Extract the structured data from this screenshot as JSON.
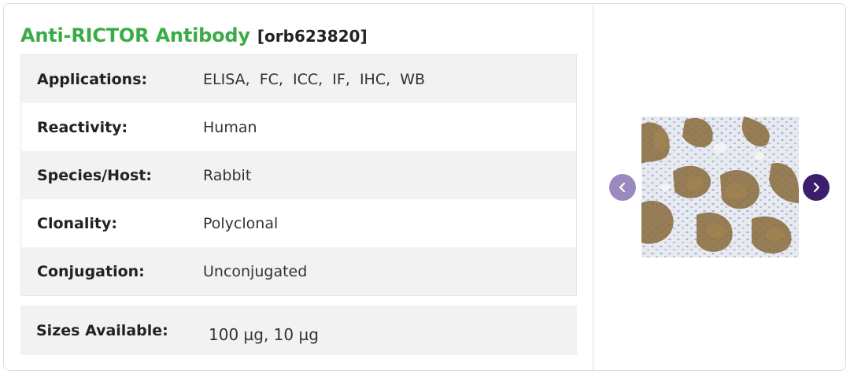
{
  "product": {
    "title": "Anti-RICTOR Antibody",
    "catalog_number": "[orb623820]"
  },
  "specs": [
    {
      "label": "Applications:",
      "value": "ELISA,  FC,  ICC,  IF,  IHC,  WB"
    },
    {
      "label": "Reactivity:",
      "value": "Human"
    },
    {
      "label": "Species/Host:",
      "value": "Rabbit"
    },
    {
      "label": "Clonality:",
      "value": "Polyclonal"
    },
    {
      "label": "Conjugation:",
      "value": "Unconjugated"
    }
  ],
  "sizes": {
    "label": "Sizes Available:",
    "value": "100 µg, 10 µg"
  },
  "gallery": {
    "prev_icon": "chevron-left-icon",
    "next_icon": "chevron-right-icon"
  },
  "colors": {
    "title_green": "#3aac45",
    "nav_prev": "#9a89bf",
    "nav_next": "#3b1e6e",
    "row_stripe": "#f2f2f2"
  }
}
